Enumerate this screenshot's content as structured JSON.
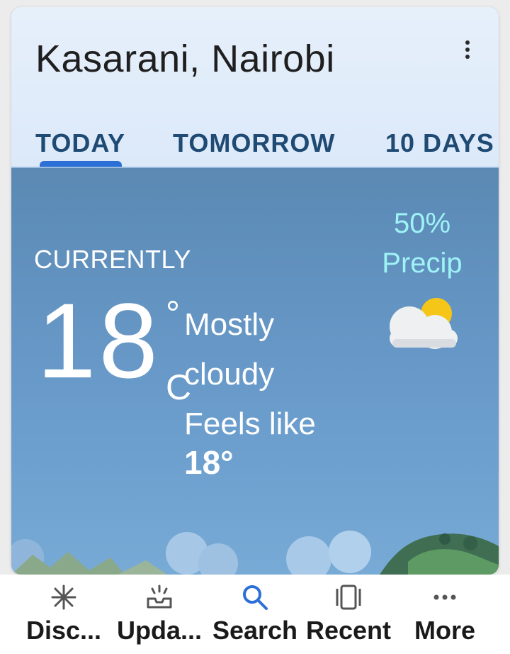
{
  "location": "Kasarani, Nairobi",
  "tabs": [
    {
      "label": "TODAY",
      "selected": true
    },
    {
      "label": "TOMORROW",
      "selected": false
    },
    {
      "label": "10 DAYS",
      "selected": false
    }
  ],
  "current": {
    "heading": "CURRENTLY",
    "temperature": "18",
    "degree_symbol": "°",
    "unit": "C",
    "condition": "Mostly cloudy",
    "feels_like_label": "Feels like",
    "feels_like_value": "18°",
    "precip_percent": "50%",
    "precip_label": "Precip",
    "weather_icon": "partly-cloudy-icon"
  },
  "bottom_nav": [
    {
      "label": "Disc...",
      "icon": "asterisk-icon",
      "active": false
    },
    {
      "label": "Upda...",
      "icon": "updates-inbox-icon",
      "active": false
    },
    {
      "label": "Search",
      "icon": "search-icon",
      "active": true
    },
    {
      "label": "Recent",
      "icon": "recent-cards-icon",
      "active": false
    },
    {
      "label": "More",
      "icon": "more-horizontal-icon",
      "active": false
    }
  ],
  "colors": {
    "accent": "#2c6fd6",
    "tab_text": "#1e4a73",
    "precip": "#9ff3f6",
    "sky": "#5b89b4"
  }
}
